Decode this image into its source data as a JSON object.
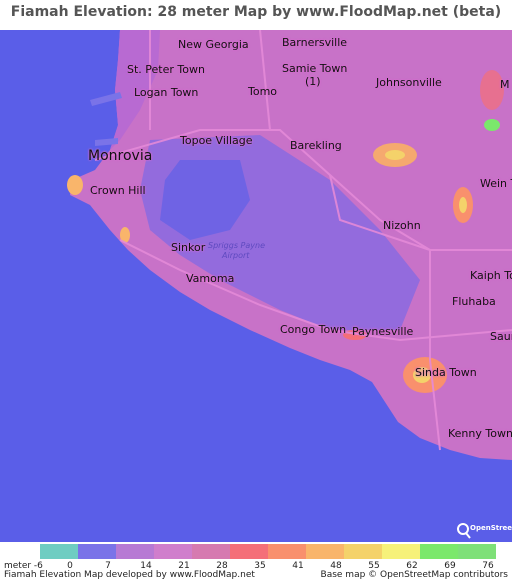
{
  "title": "Fiamah Elevation: 28 meter Map by www.FloodMap.net (beta)",
  "places": [
    {
      "name": "New Georgia",
      "cls": "place"
    },
    {
      "name": "Barnersville",
      "cls": "place"
    },
    {
      "name": "St. Peter Town",
      "cls": "place"
    },
    {
      "name": "Samie Town",
      "cls": "place"
    },
    {
      "name": "(1)",
      "cls": "place"
    },
    {
      "name": "Johnsonville",
      "cls": "place"
    },
    {
      "name": "Logan Town",
      "cls": "place"
    },
    {
      "name": "Tomo",
      "cls": "place"
    },
    {
      "name": "Topoe Village",
      "cls": "place"
    },
    {
      "name": "Barekling",
      "cls": "place"
    },
    {
      "name": "Monrovia",
      "cls": "place big"
    },
    {
      "name": "Crown Hill",
      "cls": "place"
    },
    {
      "name": "Wein T",
      "cls": "place"
    },
    {
      "name": "Nizohn",
      "cls": "place"
    },
    {
      "name": "Sinkor",
      "cls": "place"
    },
    {
      "name": "Spriggs Payne",
      "cls": "place airport"
    },
    {
      "name": "Airport",
      "cls": "place airport"
    },
    {
      "name": "Vamoma",
      "cls": "place"
    },
    {
      "name": "Kaiph To",
      "cls": "place"
    },
    {
      "name": "Fluhaba",
      "cls": "place"
    },
    {
      "name": "Congo Town",
      "cls": "place"
    },
    {
      "name": "Paynesville",
      "cls": "place"
    },
    {
      "name": "Saur",
      "cls": "place"
    },
    {
      "name": "Sinda Town",
      "cls": "place"
    },
    {
      "name": "Kenny Town",
      "cls": "place"
    },
    {
      "name": "M",
      "cls": "place"
    }
  ],
  "legend": {
    "unit": "meter -6",
    "labels": [
      "0",
      "7",
      "14",
      "21",
      "28",
      "35",
      "41",
      "48",
      "55",
      "62",
      "69",
      "76"
    ],
    "colors": [
      "#6fcdc2",
      "#7a73e8",
      "#b77ad4",
      "#d07ecc",
      "#d67ab0",
      "#f46f78",
      "#f9906d",
      "#f9b56b",
      "#f4d26a",
      "#f6f17a",
      "#7be86c",
      "#7ee078"
    ]
  },
  "footer": {
    "left": "Fiamah Elevation Map developed by www.FloodMap.net",
    "right": "Base map © OpenStreetMap contributors"
  },
  "logo_text": "OpenStreetMap"
}
